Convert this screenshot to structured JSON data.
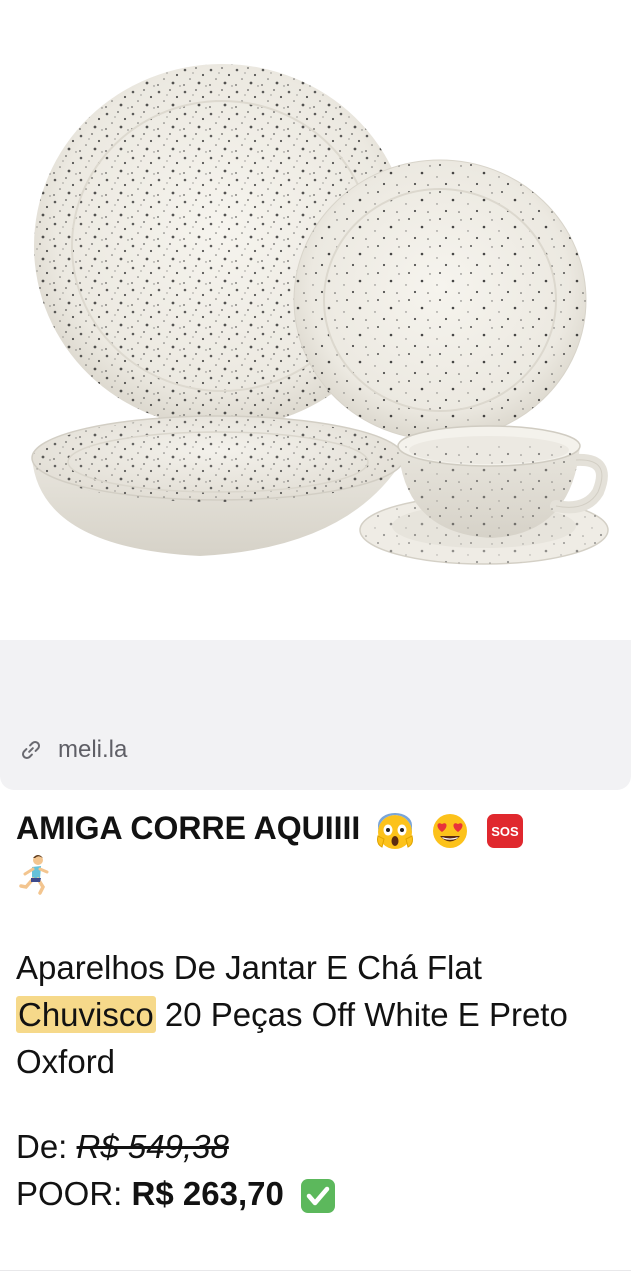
{
  "link": {
    "domain": "meli.la",
    "icon": "link-icon"
  },
  "message": {
    "headline": "AMIGA CORRE AQUIIII",
    "headline_emojis": [
      "scream-emoji",
      "heart-eyes-emoji",
      "sos-emoji",
      "running-woman-emoji"
    ],
    "sos_label": "SOS",
    "desc_before": "Aparelhos De Jantar E Chá Flat ",
    "desc_highlight": "Chuvisco",
    "desc_after": " 20 Peças Off White E Preto Oxford",
    "old_label": "De: ",
    "old_price": "R$ 549,38",
    "new_label": "POOR: ",
    "new_price": "R$ 263,70",
    "check_emoji": "check-mark-emoji"
  },
  "colors": {
    "highlight": "#f6d98a",
    "preview_bg": "#f2f2f4",
    "link_text": "#5f5f66",
    "check_green": "#5cb85c",
    "sos_red": "#e0282e"
  }
}
